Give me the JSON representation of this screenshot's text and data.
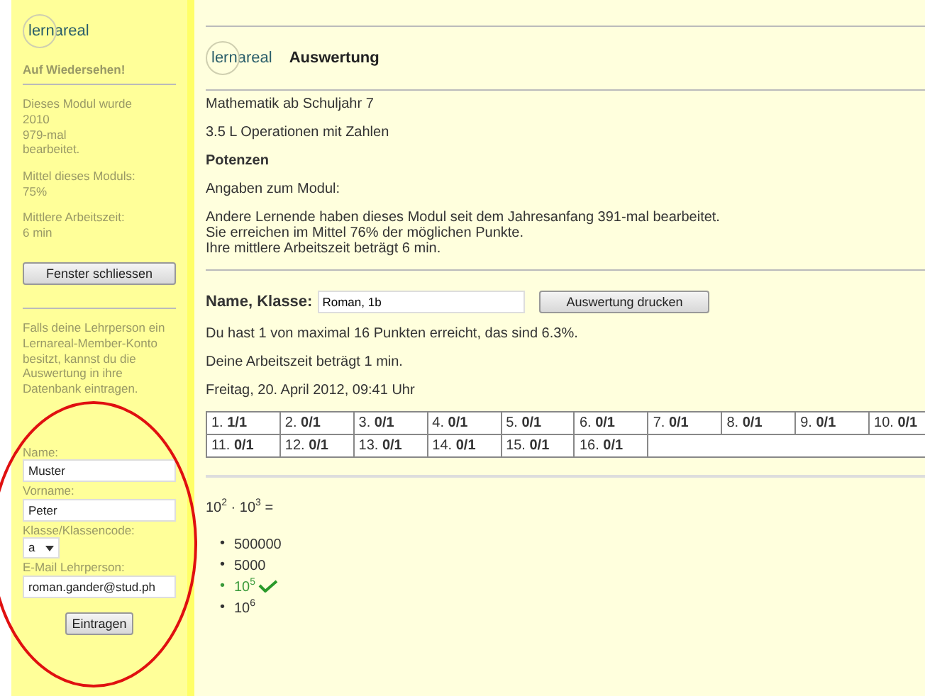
{
  "sidebar": {
    "logo": "lernareal",
    "heading": "Auf Wiedersehen!",
    "stats": [
      [
        "Dieses Modul wurde",
        "2010",
        "979-mal",
        "bearbeitet."
      ],
      [
        "Mittel dieses Moduls:",
        "75%"
      ],
      [
        "Mittlere Arbeitszeit:",
        "6 min"
      ]
    ],
    "close_button": "Fenster schliessen",
    "info": "Falls deine Lehrperson ein Lernareal-Member-Konto besitzt, kannst du die Auswertung in ihre Datenbank eintragen.",
    "fields": [
      {
        "kind": "text",
        "label": "Name:",
        "value": "Muster"
      },
      {
        "kind": "text",
        "label": "Vorname:",
        "value": "Peter"
      },
      {
        "kind": "select",
        "label": "Klasse/Klassencode:",
        "value": "a"
      },
      {
        "kind": "text",
        "label": "E-Mail Lehrperson:",
        "value": "roman.gander@stud.ph"
      }
    ],
    "submit_button": "Eintragen"
  },
  "header": {
    "logo": "lernareal",
    "title": "Auswertung"
  },
  "subject": "Mathematik ab Schuljahr 7",
  "chapter": "3.5 L Operationen mit Zahlen",
  "topic": "Potenzen",
  "module_info_label": "Angaben zum Modul:",
  "module_info": [
    "Andere Lernende haben dieses Modul seit dem Jahresanfang 391-mal bearbeitet.",
    "Sie erreichen im Mittel 76% der möglichen Punkte.",
    "Ihre mittlere Arbeitszeit beträgt 6 min."
  ],
  "name_label": "Name, Klasse:",
  "name_value": "Roman, 1b",
  "print_button": "Auswertung drucken",
  "result": "Du hast 1 von maximal 16 Punkten erreicht, das sind 6.3%.",
  "work_time": "Deine Arbeitszeit beträgt 1 min.",
  "date": "Freitag, 20. April 2012, 09:41 Uhr",
  "scores": [
    [
      "1. **1/1**",
      "2. **0/1**",
      "3. **0/1**",
      "4. **0/1**",
      "5. **0/1**",
      "6. **0/1**",
      "7. **0/1**",
      "8. **0/1**",
      "9. **0/1**",
      "10. **0/1**"
    ],
    [
      "11. **0/1**",
      "12. **0/1**",
      "13. **0/1**",
      "14. **0/1**",
      "15. **0/1**",
      "16. **0/1**"
    ]
  ],
  "question": "10$^{2}$ · 10$^{3}$ =",
  "answers": [
    {
      "marker": "•",
      "text": "500000",
      "correct": false
    },
    {
      "marker": "•",
      "text": "5000",
      "correct": false
    },
    {
      "marker": "•",
      "text": "10$^{5}$",
      "correct": true
    },
    {
      "marker": "•",
      "text": "10$^{6}$",
      "correct": false
    }
  ],
  "highlight": {
    "kind": "ellipse"
  }
}
